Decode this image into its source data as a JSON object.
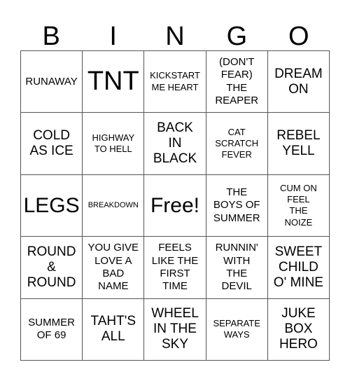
{
  "card": {
    "type": "bingo-card",
    "header_letters": [
      "B",
      "I",
      "N",
      "G",
      "O"
    ],
    "background_color": "#ffffff",
    "border_color": "#555555",
    "text_color": "#000000",
    "rows": 5,
    "columns": 5,
    "free_space": {
      "row": 2,
      "column": 2,
      "label": "Free!"
    },
    "cells": [
      {
        "text": "RUNAWAY",
        "size": "sm"
      },
      {
        "text": "TNT",
        "size": "xxl"
      },
      {
        "text": "KICKSTART\nME HEART",
        "size": "xs"
      },
      {
        "text": "(DON'T\nFEAR)\nTHE\nREAPER",
        "size": "sm"
      },
      {
        "text": "DREAM\nON",
        "size": "md"
      },
      {
        "text": "COLD\nAS ICE",
        "size": "md"
      },
      {
        "text": "HIGHWAY\nTO HELL",
        "size": "xs"
      },
      {
        "text": "BACK\nIN\nBLACK",
        "size": "md"
      },
      {
        "text": "CAT\nSCRATCH\nFEVER",
        "size": "xs"
      },
      {
        "text": "REBEL\nYELL",
        "size": "md"
      },
      {
        "text": "LEGS",
        "size": "xl"
      },
      {
        "text": "BREAKDOWN",
        "size": "xxs"
      },
      {
        "text": "Free!",
        "size": "xl"
      },
      {
        "text": "THE\nBOYS OF\nSUMMER",
        "size": "sm"
      },
      {
        "text": "CUM ON\nFEEL\nTHE\nNOIZE",
        "size": "xs"
      },
      {
        "text": "ROUND\n&\nROUND",
        "size": "md"
      },
      {
        "text": "YOU GIVE\nLOVE A\nBAD\nNAME",
        "size": "sm"
      },
      {
        "text": "FEELS\nLIKE THE\nFIRST\nTIME",
        "size": "sm"
      },
      {
        "text": "RUNNIN'\nWITH\nTHE\nDEVIL",
        "size": "sm"
      },
      {
        "text": "SWEET\nCHILD\nO' MINE",
        "size": "md"
      },
      {
        "text": "SUMMER\nOF 69",
        "size": "sm"
      },
      {
        "text": "TAHT'S\nALL",
        "size": "md"
      },
      {
        "text": "WHEEL\nIN THE\nSKY",
        "size": "md"
      },
      {
        "text": "SEPARATE\nWAYS",
        "size": "xs"
      },
      {
        "text": "JUKE\nBOX\nHERO",
        "size": "md"
      }
    ]
  }
}
